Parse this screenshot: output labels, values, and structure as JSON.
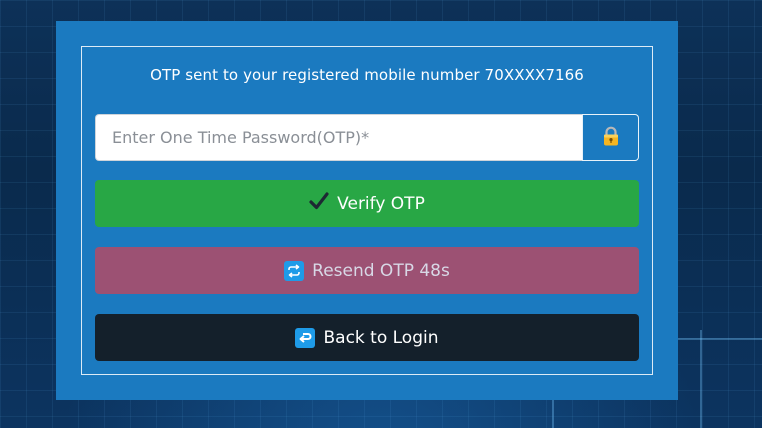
{
  "otp_message": "OTP sent to your registered mobile number 70XXXX7166",
  "otp_input": {
    "placeholder": "Enter One Time Password(OTP)*",
    "value": ""
  },
  "icons": {
    "lock": "lock-icon",
    "check": "checkmark-icon",
    "resend": "repeat-icon",
    "back": "return-arrow-icon"
  },
  "buttons": {
    "verify_label": "Verify OTP",
    "resend_label": "Resend OTP 48s",
    "back_label": "Back to Login"
  },
  "colors": {
    "card_background": "#1b7ac0",
    "verify": "#28a745",
    "resend": "#9c5173",
    "back": "#14202b",
    "icon_blue": "#1e9be8"
  }
}
